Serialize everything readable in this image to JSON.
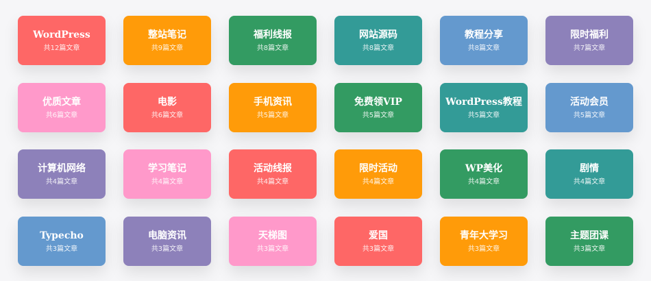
{
  "colors": {
    "red": "#fe6766",
    "orange": "#ff9b09",
    "green": "#339b62",
    "teal": "#339b97",
    "blue": "#6499ce",
    "purple": "#8d81ba",
    "pink": "#ff99ca"
  },
  "categories": [
    {
      "title": "WordPress",
      "count": "共12篇文章",
      "color": "#fe6766"
    },
    {
      "title": "整站笔记",
      "count": "共9篇文章",
      "color": "#ff9b09"
    },
    {
      "title": "福利线报",
      "count": "共8篇文章",
      "color": "#339b62"
    },
    {
      "title": "网站源码",
      "count": "共8篇文章",
      "color": "#339b97"
    },
    {
      "title": "教程分享",
      "count": "共8篇文章",
      "color": "#6499ce"
    },
    {
      "title": "限时福利",
      "count": "共7篇文章",
      "color": "#8d81ba"
    },
    {
      "title": "优质文章",
      "count": "共6篇文章",
      "color": "#ff99ca"
    },
    {
      "title": "电影",
      "count": "共6篇文章",
      "color": "#fe6766"
    },
    {
      "title": "手机资讯",
      "count": "共5篇文章",
      "color": "#ff9b09"
    },
    {
      "title": "免费领VIP",
      "count": "共5篇文章",
      "color": "#339b62"
    },
    {
      "title": "WordPress教程",
      "count": "共5篇文章",
      "color": "#339b97"
    },
    {
      "title": "活动会员",
      "count": "共5篇文章",
      "color": "#6499ce"
    },
    {
      "title": "计算机网络",
      "count": "共4篇文章",
      "color": "#8d81ba"
    },
    {
      "title": "学习笔记",
      "count": "共4篇文章",
      "color": "#ff99ca"
    },
    {
      "title": "活动线报",
      "count": "共4篇文章",
      "color": "#fe6766"
    },
    {
      "title": "限时活动",
      "count": "共4篇文章",
      "color": "#ff9b09"
    },
    {
      "title": "WP美化",
      "count": "共4篇文章",
      "color": "#339b62"
    },
    {
      "title": "剧情",
      "count": "共4篇文章",
      "color": "#339b97"
    },
    {
      "title": "Typecho",
      "count": "共3篇文章",
      "color": "#6499ce"
    },
    {
      "title": "电脑资讯",
      "count": "共3篇文章",
      "color": "#8d81ba"
    },
    {
      "title": "天梯图",
      "count": "共3篇文章",
      "color": "#ff99ca"
    },
    {
      "title": "爱国",
      "count": "共3篇文章",
      "color": "#fe6766"
    },
    {
      "title": "青年大学习",
      "count": "共3篇文章",
      "color": "#ff9b09"
    },
    {
      "title": "主题团课",
      "count": "共3篇文章",
      "color": "#339b62"
    }
  ]
}
